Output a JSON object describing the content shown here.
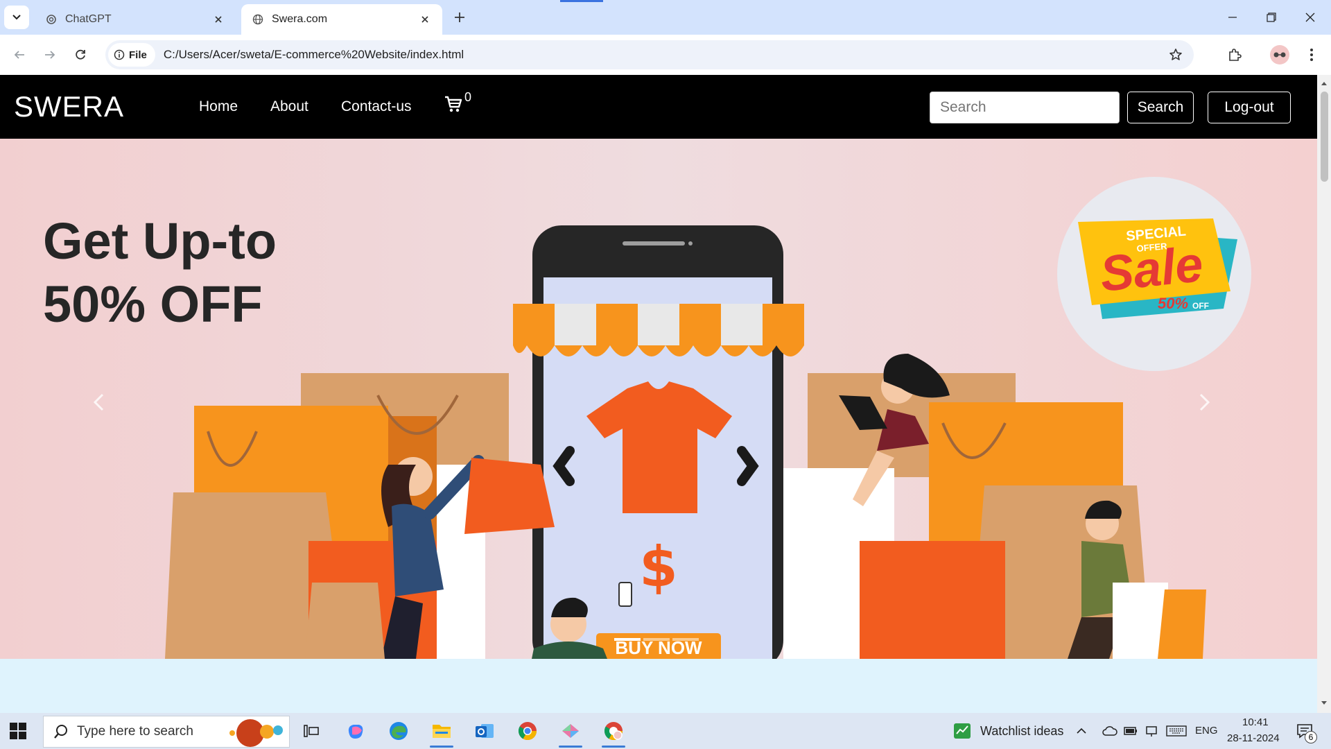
{
  "browser": {
    "tabs": [
      {
        "title": "ChatGPT",
        "active": false
      },
      {
        "title": "Swera.com",
        "active": true
      }
    ],
    "site_chip": "File",
    "url": "C:/Users/Acer/sweta/E-commerce%20Website/index.html"
  },
  "navbar": {
    "brand": "SWERA",
    "links": [
      "Home",
      "About",
      "Contact-us"
    ],
    "cart_count": "0",
    "search_placeholder": "Search",
    "search_button": "Search",
    "logout_button": "Log-out"
  },
  "hero": {
    "headline_line1": "Get Up-to",
    "headline_line2": "50% OFF",
    "badge_top": "SPECIAL",
    "badge_offer": "OFFER",
    "badge_word": "Sale",
    "badge_percent": "50%",
    "badge_off": "OFF",
    "button_text": "BUY NOW",
    "currency_symbol": "$",
    "slides": 3,
    "active_slide": 1,
    "colors": {
      "orange": "#f7941d",
      "deep_orange": "#f25c1f",
      "tan": "#d9a06b"
    }
  },
  "taskbar": {
    "search_placeholder": "Type here to search",
    "widget_text": "Watchlist ideas",
    "language": "ENG",
    "time": "10:41",
    "date": "28-11-2024",
    "notification_count": "6"
  }
}
